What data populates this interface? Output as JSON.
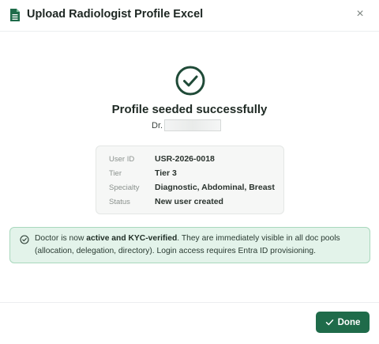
{
  "dialog": {
    "title": "Upload Radiologist Profile Excel",
    "icon": "excel-file-icon",
    "close_icon": "close-icon",
    "close_label": "×"
  },
  "result": {
    "icon": "check-circle-icon",
    "heading": "Profile seeded successfully",
    "doctor_prefix": "Dr."
  },
  "details": {
    "rows": [
      {
        "key": "User ID",
        "value": "USR-2026-0018"
      },
      {
        "key": "Tier",
        "value": "Tier 3"
      },
      {
        "key": "Specialty",
        "value": "Diagnostic, Abdominal, Breast"
      },
      {
        "key": "Status",
        "value": "New user created"
      }
    ]
  },
  "notice": {
    "icon": "check-circle-icon",
    "prefix": "Doctor is now ",
    "emphasis": "active and KYC-verified",
    "suffix": ". They are immediately visible in all doc pools (allocation, delegation, directory). Login access requires Entra ID provisioning."
  },
  "footer": {
    "done_label": "Done",
    "done_icon": "check-icon"
  },
  "colors": {
    "accent": "#1f6b4a",
    "banner_bg": "#e3f3ea",
    "banner_border": "#a9d8bd",
    "card_bg": "#f6f7f6"
  }
}
